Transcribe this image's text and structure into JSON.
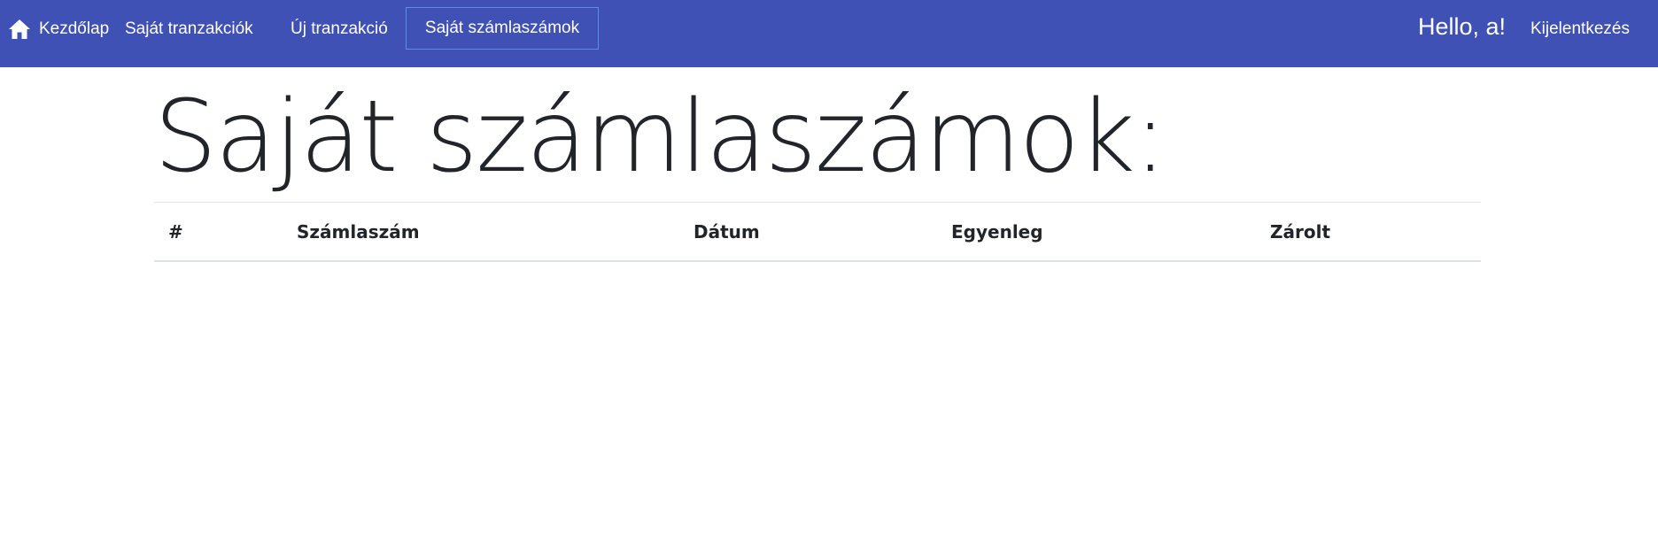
{
  "navbar": {
    "home_label": "Kezdőlap",
    "transactions_label": "Saját tranzakciók",
    "new_transaction_label": "Új tranzakció",
    "accounts_label": "Saját számlaszámok",
    "greeting": "Hello, a!",
    "logout_label": "Kijelentkezés",
    "background_color": "#3f51b5",
    "active_border_color": "#5b8def",
    "home_icon": "home-icon"
  },
  "page": {
    "title": "Saját számlaszámok:"
  },
  "table": {
    "columns": [
      "#",
      "Számlaszám",
      "Dátum",
      "Egyenleg",
      "Zárolt"
    ],
    "rows": []
  }
}
